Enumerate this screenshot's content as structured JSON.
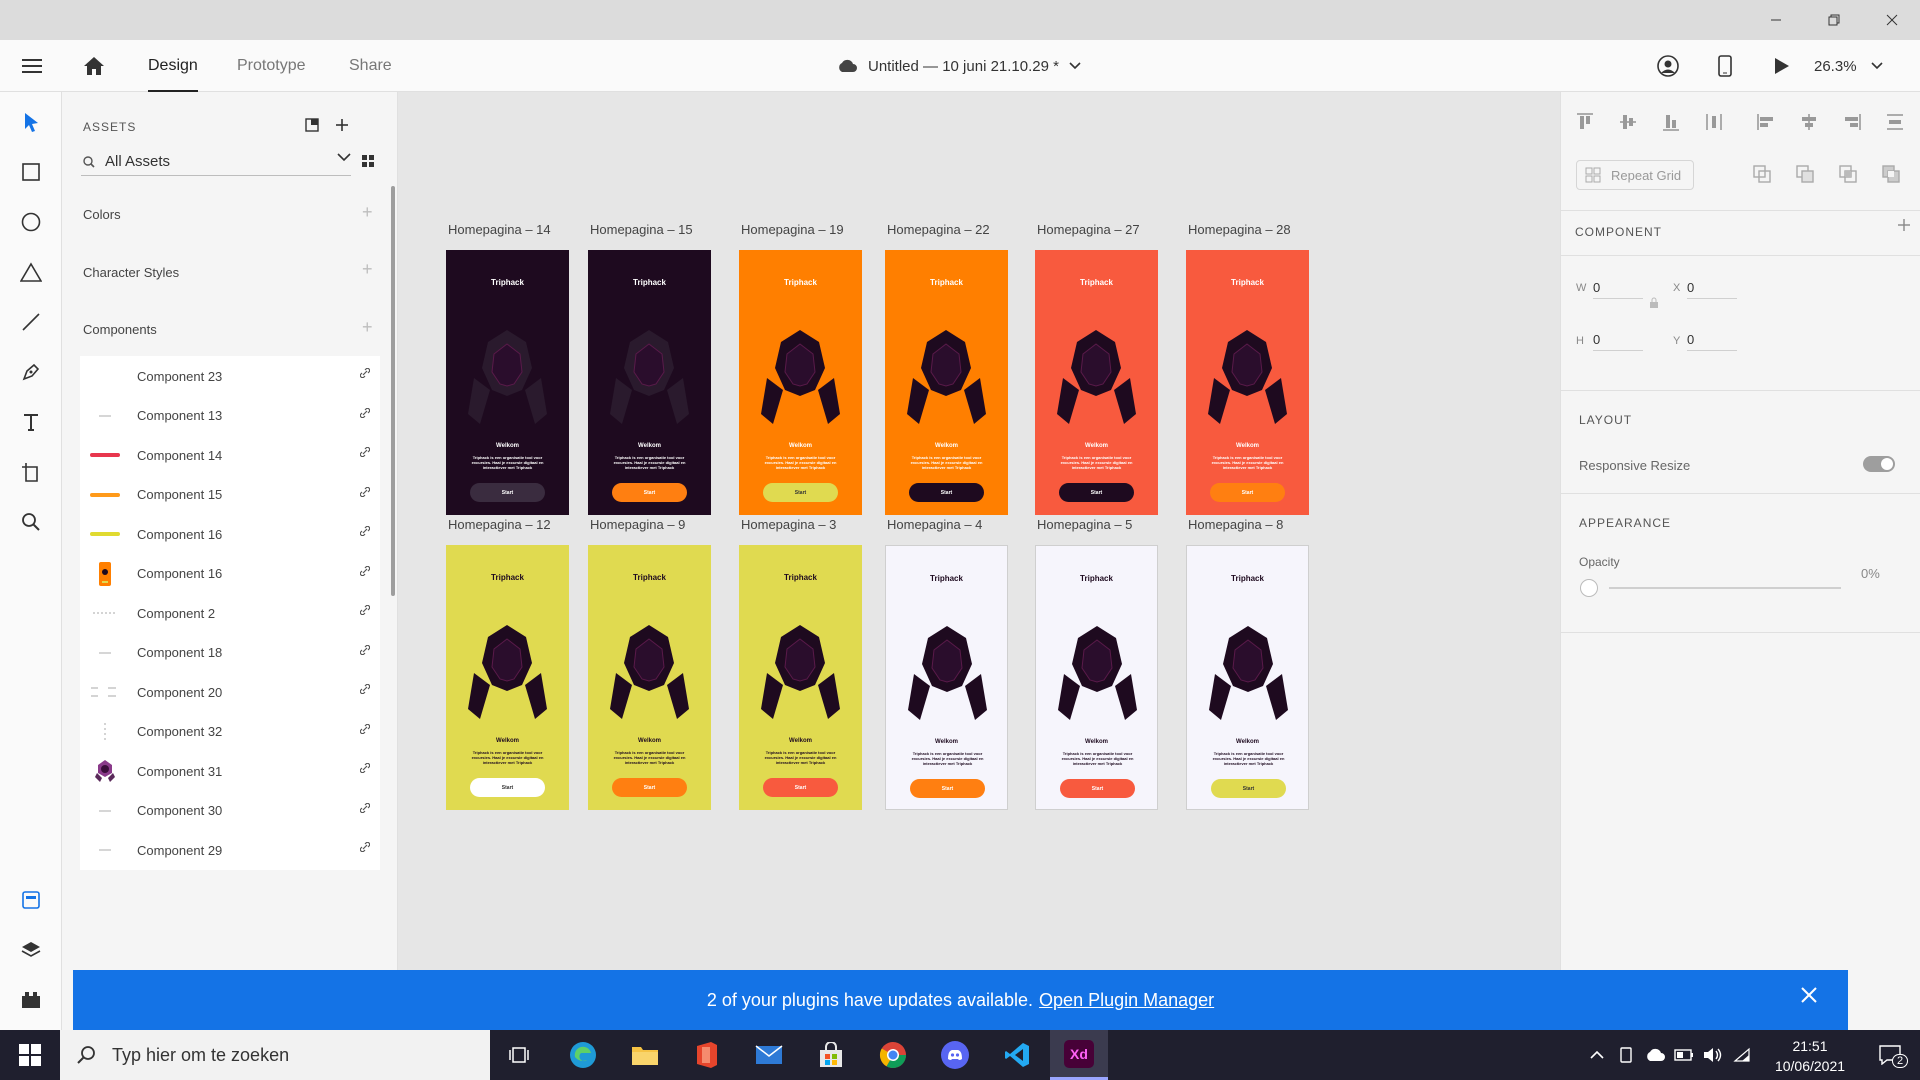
{
  "header": {
    "tabs": [
      "Design",
      "Prototype",
      "Share"
    ],
    "doc_title": "Untitled — 10 juni 21.10.29 *",
    "zoom": "26.3%"
  },
  "assets": {
    "title": "ASSETS",
    "search_value": "All Assets",
    "sections": [
      "Colors",
      "Character Styles",
      "Components"
    ],
    "components": [
      {
        "name": "Component 23",
        "thumb": "none"
      },
      {
        "name": "Component 13",
        "thumb": "short-line"
      },
      {
        "name": "Component 14",
        "thumb": "red-bar"
      },
      {
        "name": "Component 15",
        "thumb": "orange-bar"
      },
      {
        "name": "Component 16",
        "thumb": "yellow-bar"
      },
      {
        "name": "Component 16",
        "thumb": "phone"
      },
      {
        "name": "Component 2",
        "thumb": "dashed-line"
      },
      {
        "name": "Component 18",
        "thumb": "short-line"
      },
      {
        "name": "Component 20",
        "thumb": "double-dash"
      },
      {
        "name": "Component 32",
        "thumb": "vertical-dots"
      },
      {
        "name": "Component 31",
        "thumb": "purple-hood"
      },
      {
        "name": "Component 30",
        "thumb": "short-line"
      },
      {
        "name": "Component 29",
        "thumb": "short-line"
      }
    ]
  },
  "canvas": {
    "row1": [
      {
        "label": "Homepagina – 14",
        "bg": "#1e0a1f",
        "fg": "#ffffff",
        "btn_bg": "#3a2c3f",
        "btn_fg": "#ffffff",
        "hood_arms": "#2a1a2d"
      },
      {
        "label": "Homepagina – 15",
        "bg": "#1e0a1f",
        "fg": "#ffffff",
        "btn_bg": "#ff7f11",
        "btn_fg": "#ffffff",
        "hood_arms": "#2a1a2d"
      },
      {
        "label": "Homepagina – 19",
        "bg": "#ff7f00",
        "fg": "#ffffff",
        "btn_bg": "#e0da50",
        "btn_fg": "#333333",
        "hood_arms": "#1e0a1f"
      },
      {
        "label": "Homepagina – 22",
        "bg": "#ff7f00",
        "fg": "#ffffff",
        "btn_bg": "#1e0a1f",
        "btn_fg": "#ffffff",
        "hood_arms": "#1e0a1f"
      },
      {
        "label": "Homepagina – 27",
        "bg": "#f85a3e",
        "fg": "#ffffff",
        "btn_bg": "#1e0a1f",
        "btn_fg": "#ffffff",
        "hood_arms": "#1e0a1f"
      },
      {
        "label": "Homepagina – 28",
        "bg": "#f85a3e",
        "fg": "#ffffff",
        "btn_bg": "#ff7f11",
        "btn_fg": "#ffffff",
        "hood_arms": "#1e0a1f"
      }
    ],
    "row2": [
      {
        "label": "Homepagina – 12",
        "bg": "#e0da50",
        "fg": "#1e0a1f",
        "btn_bg": "#ffffff",
        "btn_fg": "#333333",
        "hood_arms": "#1e0a1f"
      },
      {
        "label": "Homepagina – 9",
        "bg": "#e0da50",
        "fg": "#1e0a1f",
        "btn_bg": "#ff7f11",
        "btn_fg": "#ffffff",
        "hood_arms": "#1e0a1f"
      },
      {
        "label": "Homepagina – 3",
        "bg": "#e0da50",
        "fg": "#1e0a1f",
        "btn_bg": "#f85a3e",
        "btn_fg": "#ffffff",
        "hood_arms": "#1e0a1f"
      },
      {
        "label": "Homepagina – 4",
        "bg": "#f6f5fc",
        "fg": "#1e0a1f",
        "btn_bg": "#ff7f11",
        "btn_fg": "#ffffff",
        "hood_arms": "#1e0a1f"
      },
      {
        "label": "Homepagina – 5",
        "bg": "#f6f5fc",
        "fg": "#1e0a1f",
        "btn_bg": "#f85a3e",
        "btn_fg": "#ffffff",
        "hood_arms": "#1e0a1f"
      },
      {
        "label": "Homepagina – 8",
        "bg": "#f6f5fc",
        "fg": "#1e0a1f",
        "btn_bg": "#e0da50",
        "btn_fg": "#333333",
        "hood_arms": "#1e0a1f"
      }
    ],
    "artboard_text": {
      "brand": "Triphack",
      "welcome": "Welkom",
      "body": "Triphack is een organisatie tool voor excursies. Haal je excursie digitaal en interactiever met Triphack",
      "button": "Start"
    }
  },
  "props": {
    "repeat_grid": "Repeat Grid",
    "component_title": "COMPONENT",
    "w_label": "W",
    "w_value": "0",
    "h_label": "H",
    "h_value": "0",
    "x_label": "X",
    "x_value": "0",
    "y_label": "Y",
    "y_value": "0",
    "layout_title": "LAYOUT",
    "responsive_resize": "Responsive Resize",
    "responsive_resize_on": true,
    "appearance_title": "APPEARANCE",
    "opacity_label": "Opacity",
    "opacity_value": "0%"
  },
  "notification": {
    "message": "2 of your plugins have updates available.",
    "link": "Open Plugin Manager"
  },
  "taskbar": {
    "search_placeholder": "Typ hier om te zoeken",
    "time": "21:51",
    "date": "10/06/2021",
    "notification_count": "2",
    "apps": [
      "task-view",
      "edge",
      "file-explorer",
      "office",
      "mail",
      "store",
      "chrome",
      "discord",
      "vscode",
      "adobe-xd"
    ]
  }
}
